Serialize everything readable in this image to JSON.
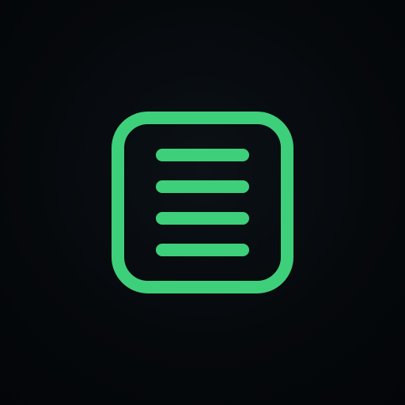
{
  "icon": {
    "name": "document-lines-icon",
    "shape": "rounded-square-outline",
    "line_count": 4
  },
  "colors": {
    "background": "#06090c",
    "accent": "#3ecf7a"
  }
}
